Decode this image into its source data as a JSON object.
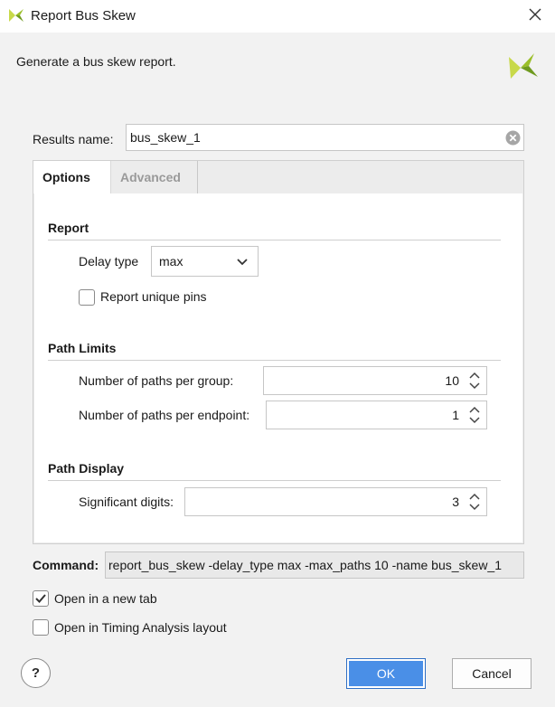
{
  "window": {
    "title": "Report Bus Skew",
    "description": "Generate a bus skew report."
  },
  "results": {
    "label": "Results name:",
    "value": "bus_skew_1"
  },
  "tabs": [
    {
      "label": "Options",
      "active": true
    },
    {
      "label": "Advanced",
      "active": false
    }
  ],
  "report": {
    "section_title": "Report",
    "delay_type_label": "Delay type",
    "delay_type_value": "max",
    "unique_pins_label": "Report unique pins",
    "unique_pins_checked": false
  },
  "path_limits": {
    "section_title": "Path Limits",
    "per_group_label": "Number of paths per group:",
    "per_group_value": "10",
    "per_endpoint_label": "Number of paths per endpoint:",
    "per_endpoint_value": "1"
  },
  "path_display": {
    "section_title": "Path Display",
    "sig_digits_label": "Significant digits:",
    "sig_digits_value": "3"
  },
  "command": {
    "label": "Command:",
    "value": "report_bus_skew -delay_type max -max_paths 10 -name bus_skew_1"
  },
  "options": {
    "new_tab_label": "Open in a new tab",
    "new_tab_checked": true,
    "timing_layout_label": "Open in Timing Analysis layout",
    "timing_layout_checked": false
  },
  "buttons": {
    "help": "?",
    "ok": "OK",
    "cancel": "Cancel"
  },
  "colors": {
    "accent": "#4a8fe7",
    "logo_green": "#9bbf2a"
  }
}
